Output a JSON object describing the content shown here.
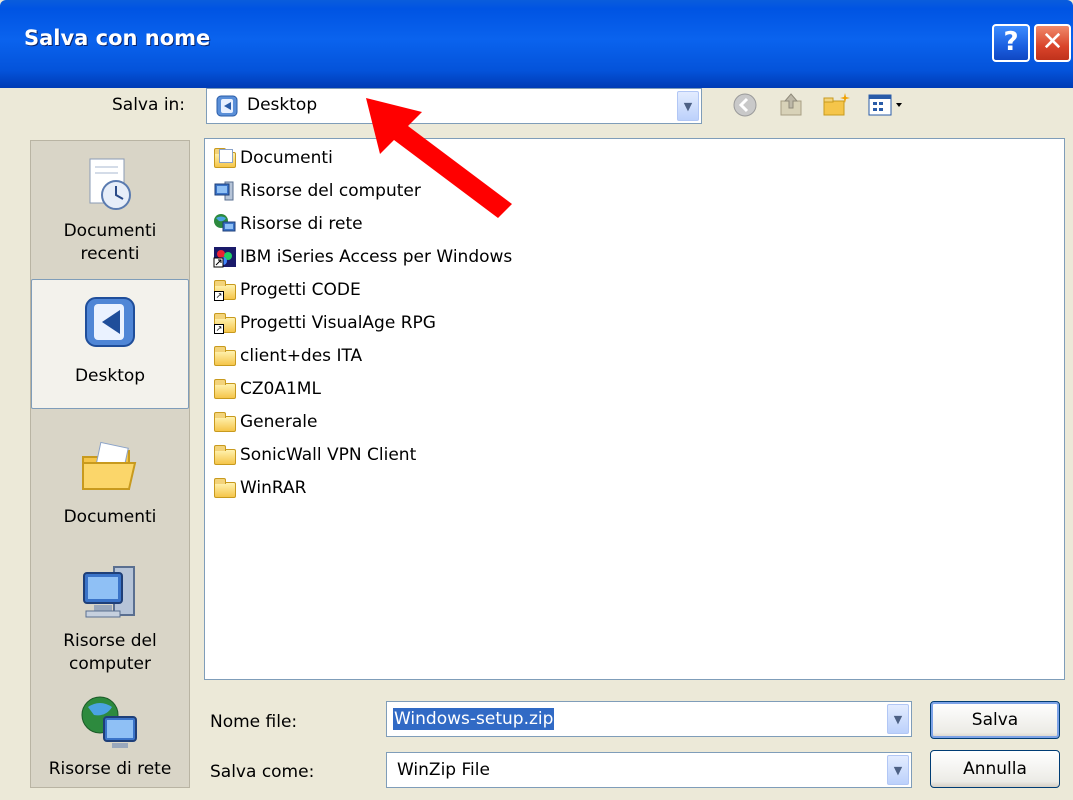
{
  "window": {
    "title": "Salva con nome"
  },
  "toolbar": {
    "save_in_label": "Salva in:",
    "save_in_value": "Desktop",
    "icons": [
      "back-icon",
      "up-folder-icon",
      "new-folder-icon",
      "views-menu-icon"
    ]
  },
  "places": [
    {
      "label_line1": "Documenti",
      "label_line2": "recenti",
      "icon": "recent-documents-icon"
    },
    {
      "label_line1": "Desktop",
      "label_line2": "",
      "icon": "desktop-icon",
      "selected": true
    },
    {
      "label_line1": "Documenti",
      "label_line2": "",
      "icon": "my-documents-icon"
    },
    {
      "label_line1": "Risorse del",
      "label_line2": "computer",
      "icon": "my-computer-icon"
    },
    {
      "label_line1": "Risorse di rete",
      "label_line2": "",
      "icon": "network-places-icon"
    }
  ],
  "files": [
    {
      "name": "Documenti",
      "icon": "documents-folder-icon"
    },
    {
      "name": "Risorse del computer",
      "icon": "computer-icon"
    },
    {
      "name": "Risorse di rete",
      "icon": "network-icon"
    },
    {
      "name": "IBM iSeries Access per Windows",
      "icon": "ibm-iseries-icon"
    },
    {
      "name": "Progetti CODE",
      "icon": "folder-shortcut-icon"
    },
    {
      "name": "Progetti VisualAge RPG",
      "icon": "folder-shortcut-icon"
    },
    {
      "name": "client+des ITA",
      "icon": "folder-icon"
    },
    {
      "name": "CZ0A1ML",
      "icon": "folder-icon"
    },
    {
      "name": "Generale",
      "icon": "folder-icon"
    },
    {
      "name": "SonicWall VPN Client",
      "icon": "folder-icon"
    },
    {
      "name": "WinRAR",
      "icon": "folder-icon"
    }
  ],
  "form": {
    "filename_label": "Nome file:",
    "filename_value": "Windows-setup.zip",
    "filetype_label": "Salva come:",
    "filetype_value": "WinZip File"
  },
  "buttons": {
    "save": "Salva",
    "cancel": "Annulla"
  },
  "colors": {
    "titlebar": "#0054e3",
    "annotation_arrow": "#ff0000",
    "selection": "#316ac5"
  }
}
